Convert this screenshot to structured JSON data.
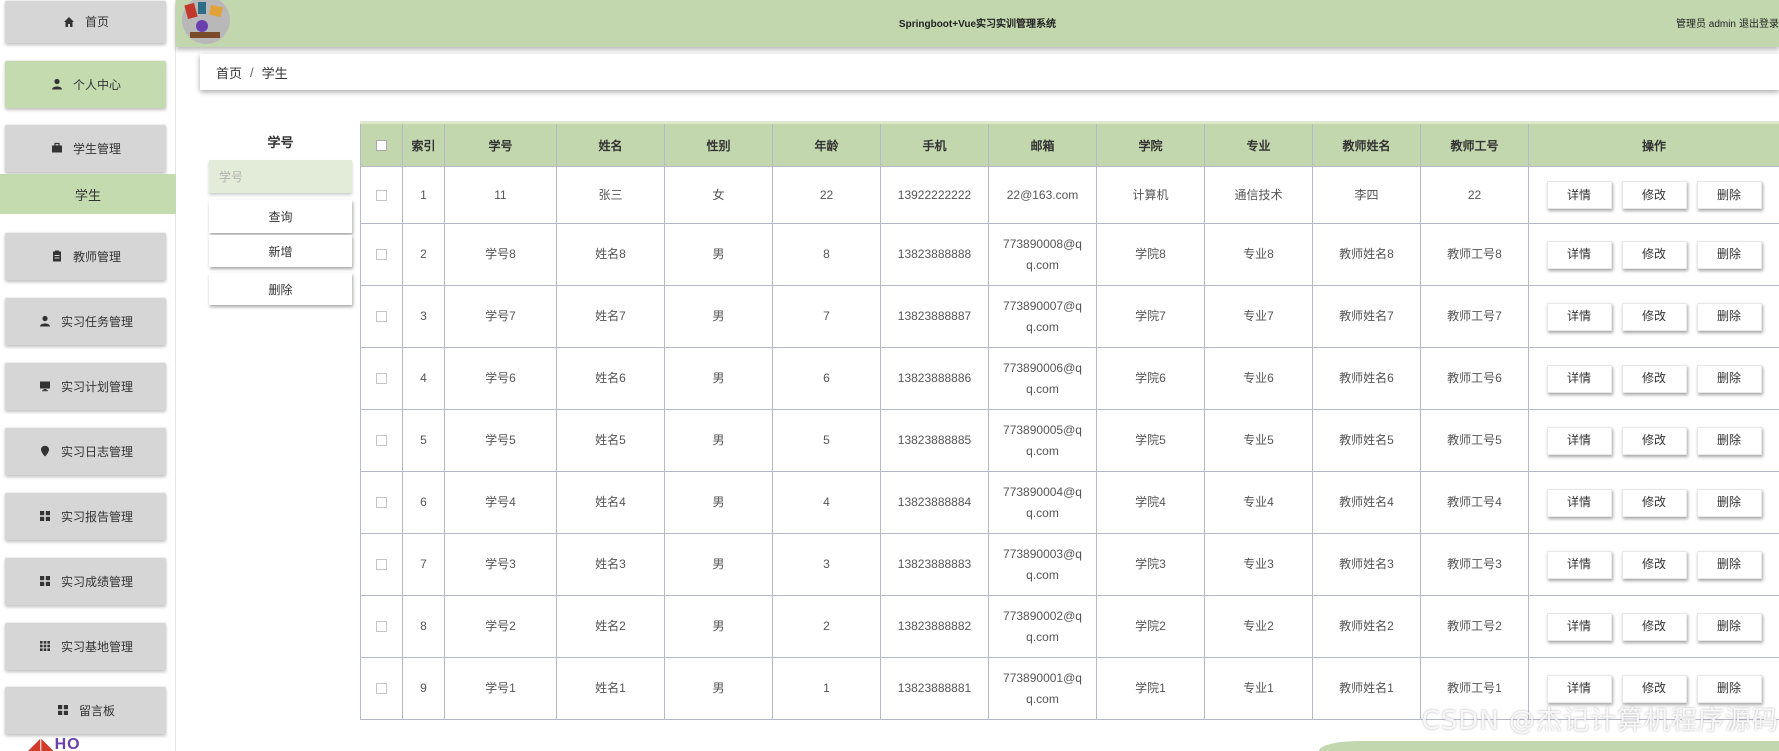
{
  "app": {
    "title": "Springboot+Vue实习实训管理系统",
    "user_label": "管理员 admin",
    "logout": "退出登录"
  },
  "sidebar": {
    "items": [
      {
        "label": "首页",
        "icon": "home-icon"
      },
      {
        "label": "个人中心",
        "icon": "user-icon"
      },
      {
        "label": "学生管理",
        "icon": "briefcase-icon"
      },
      {
        "label": "教师管理",
        "icon": "clipboard-icon"
      },
      {
        "label": "实习任务管理",
        "icon": "user-icon"
      },
      {
        "label": "实习计划管理",
        "icon": "monitor-icon"
      },
      {
        "label": "实习日志管理",
        "icon": "location-pin-icon"
      },
      {
        "label": "实习报告管理",
        "icon": "grid-icon"
      },
      {
        "label": "实习成绩管理",
        "icon": "grid-icon"
      },
      {
        "label": "实习基地管理",
        "icon": "dots-grid-icon"
      },
      {
        "label": "留言板",
        "icon": "grid-icon"
      }
    ],
    "submenu_active": "学生",
    "bottom_logo": "HO"
  },
  "breadcrumb": {
    "home": "首页",
    "separator": "/",
    "current": "学生"
  },
  "filter": {
    "label": "学号",
    "placeholder": "学号",
    "query_button": "查询",
    "add_button": "新增",
    "delete_button": "删除"
  },
  "table": {
    "columns": [
      "索引",
      "学号",
      "姓名",
      "性别",
      "年龄",
      "手机",
      "邮箱",
      "学院",
      "专业",
      "教师姓名",
      "教师工号",
      "操作"
    ],
    "actions": {
      "detail": "详情",
      "edit": "修改",
      "delete": "删除"
    },
    "rows": [
      {
        "index": "1",
        "student_no": "11",
        "name": "张三",
        "gender": "女",
        "age": "22",
        "phone": "13922222222",
        "email_line1": "22@163.com",
        "email_line2": "",
        "college": "计算机",
        "major": "通信技术",
        "teacher_name": "李四",
        "teacher_no": "22"
      },
      {
        "index": "2",
        "student_no": "学号8",
        "name": "姓名8",
        "gender": "男",
        "age": "8",
        "phone": "13823888888",
        "email_line1": "773890008@q",
        "email_line2": "q.com",
        "college": "学院8",
        "major": "专业8",
        "teacher_name": "教师姓名8",
        "teacher_no": "教师工号8"
      },
      {
        "index": "3",
        "student_no": "学号7",
        "name": "姓名7",
        "gender": "男",
        "age": "7",
        "phone": "13823888887",
        "email_line1": "773890007@q",
        "email_line2": "q.com",
        "college": "学院7",
        "major": "专业7",
        "teacher_name": "教师姓名7",
        "teacher_no": "教师工号7"
      },
      {
        "index": "4",
        "student_no": "学号6",
        "name": "姓名6",
        "gender": "男",
        "age": "6",
        "phone": "13823888886",
        "email_line1": "773890006@q",
        "email_line2": "q.com",
        "college": "学院6",
        "major": "专业6",
        "teacher_name": "教师姓名6",
        "teacher_no": "教师工号6"
      },
      {
        "index": "5",
        "student_no": "学号5",
        "name": "姓名5",
        "gender": "男",
        "age": "5",
        "phone": "13823888885",
        "email_line1": "773890005@q",
        "email_line2": "q.com",
        "college": "学院5",
        "major": "专业5",
        "teacher_name": "教师姓名5",
        "teacher_no": "教师工号5"
      },
      {
        "index": "6",
        "student_no": "学号4",
        "name": "姓名4",
        "gender": "男",
        "age": "4",
        "phone": "13823888884",
        "email_line1": "773890004@q",
        "email_line2": "q.com",
        "college": "学院4",
        "major": "专业4",
        "teacher_name": "教师姓名4",
        "teacher_no": "教师工号4"
      },
      {
        "index": "7",
        "student_no": "学号3",
        "name": "姓名3",
        "gender": "男",
        "age": "3",
        "phone": "13823888883",
        "email_line1": "773890003@q",
        "email_line2": "q.com",
        "college": "学院3",
        "major": "专业3",
        "teacher_name": "教师姓名3",
        "teacher_no": "教师工号3"
      },
      {
        "index": "8",
        "student_no": "学号2",
        "name": "姓名2",
        "gender": "男",
        "age": "2",
        "phone": "13823888882",
        "email_line1": "773890002@q",
        "email_line2": "q.com",
        "college": "学院2",
        "major": "专业2",
        "teacher_name": "教师姓名2",
        "teacher_no": "教师工号2"
      },
      {
        "index": "9",
        "student_no": "学号1",
        "name": "姓名1",
        "gender": "男",
        "age": "1",
        "phone": "13823888881",
        "email_line1": "773890001@q",
        "email_line2": "q.com",
        "college": "学院1",
        "major": "专业1",
        "teacher_name": "教师姓名1",
        "teacher_no": "教师工号1"
      }
    ]
  },
  "watermark": "CSDN @杰记计算机程序源码",
  "colors": {
    "accent_green": "#c3d7ae",
    "active_green": "#c4dbb0",
    "menu_gray": "#d6d6d6"
  }
}
